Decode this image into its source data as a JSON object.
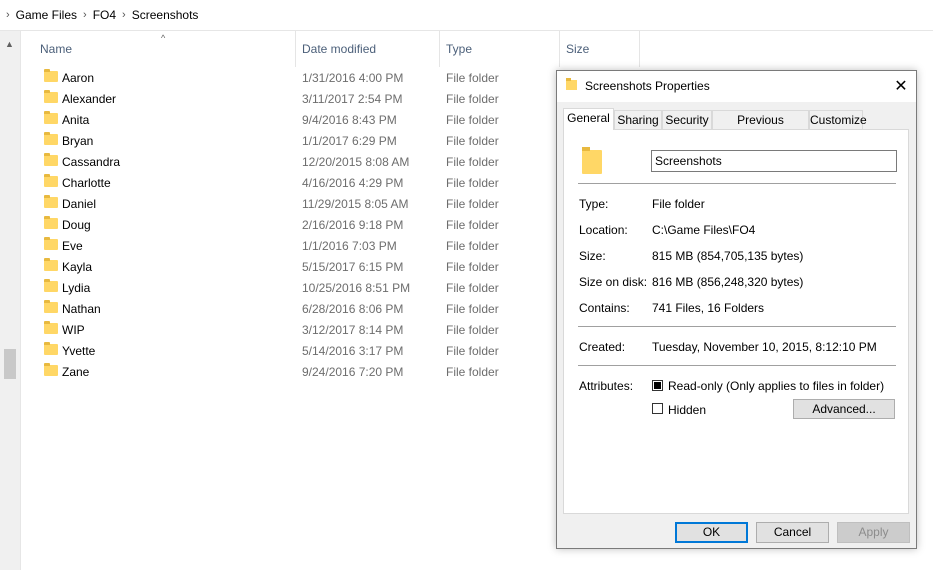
{
  "breadcrumb": {
    "items": [
      "Game Files",
      "FO4",
      "Screenshots"
    ]
  },
  "columns": {
    "name": "Name",
    "date": "Date modified",
    "type": "Type",
    "size": "Size"
  },
  "files": [
    {
      "name": "Aaron",
      "date": "1/31/2016 4:00 PM",
      "type": "File folder"
    },
    {
      "name": "Alexander",
      "date": "3/11/2017 2:54 PM",
      "type": "File folder"
    },
    {
      "name": "Anita",
      "date": "9/4/2016 8:43 PM",
      "type": "File folder"
    },
    {
      "name": "Bryan",
      "date": "1/1/2017 6:29 PM",
      "type": "File folder"
    },
    {
      "name": "Cassandra",
      "date": "12/20/2015 8:08 AM",
      "type": "File folder"
    },
    {
      "name": "Charlotte",
      "date": "4/16/2016 4:29 PM",
      "type": "File folder"
    },
    {
      "name": "Daniel",
      "date": "11/29/2015 8:05 AM",
      "type": "File folder"
    },
    {
      "name": "Doug",
      "date": "2/16/2016 9:18 PM",
      "type": "File folder"
    },
    {
      "name": "Eve",
      "date": "1/1/2016 7:03 PM",
      "type": "File folder"
    },
    {
      "name": "Kayla",
      "date": "5/15/2017 6:15 PM",
      "type": "File folder"
    },
    {
      "name": "Lydia",
      "date": "10/25/2016 8:51 PM",
      "type": "File folder"
    },
    {
      "name": "Nathan",
      "date": "6/28/2016 8:06 PM",
      "type": "File folder"
    },
    {
      "name": "WIP",
      "date": "3/12/2017 8:14 PM",
      "type": "File folder"
    },
    {
      "name": "Yvette",
      "date": "5/14/2016 3:17 PM",
      "type": "File folder"
    },
    {
      "name": "Zane",
      "date": "9/24/2016 7:20 PM",
      "type": "File folder"
    }
  ],
  "dialog": {
    "title": "Screenshots Properties",
    "tabs": [
      "General",
      "Sharing",
      "Security",
      "Previous Versions",
      "Customize"
    ],
    "folder_name": "Screenshots",
    "type_label": "Type:",
    "type_value": "File folder",
    "location_label": "Location:",
    "location_value": "C:\\Game Files\\FO4",
    "size_label": "Size:",
    "size_value": "815 MB (854,705,135 bytes)",
    "size_on_disk_label": "Size on disk:",
    "size_on_disk_value": "816 MB (856,248,320 bytes)",
    "contains_label": "Contains:",
    "contains_value": "741 Files, 16 Folders",
    "created_label": "Created:",
    "created_value": "Tuesday, November 10, 2015, 8:12:10 PM",
    "attributes_label": "Attributes:",
    "readonly_label": "Read-only (Only applies to files in folder)",
    "hidden_label": "Hidden",
    "advanced_label": "Advanced...",
    "ok_label": "OK",
    "cancel_label": "Cancel",
    "apply_label": "Apply"
  },
  "colors": {
    "folder": "#ffd766",
    "header_text": "#4c607a",
    "ok_border": "#0078d7"
  }
}
